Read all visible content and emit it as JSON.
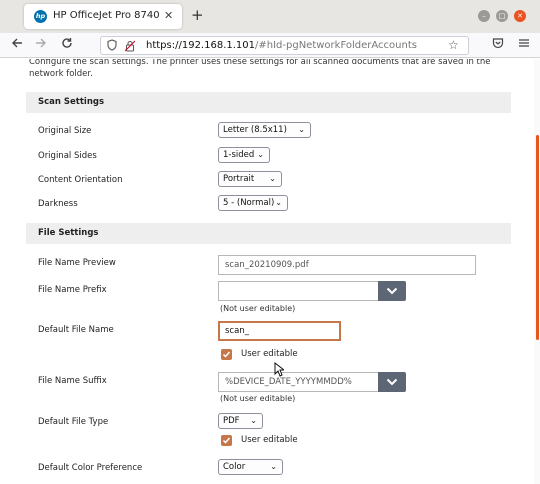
{
  "browser": {
    "tab_title": "HP OfficeJet Pro 8740",
    "tab_close": "✕",
    "favicon_text": "hp",
    "new_tab": "+",
    "url_host": "https://192.168.1.101",
    "url_path": "/#hId-pgNetworkFolderAccounts"
  },
  "page": {
    "intro": "Configure the scan settings. The printer uses these settings for all scanned documents that are saved in the network folder.",
    "scan_settings": {
      "header": "Scan Settings",
      "rows": [
        {
          "label": "Original Size",
          "value": "Letter (8.5x11)"
        },
        {
          "label": "Original Sides",
          "value": "1-sided"
        },
        {
          "label": "Content Orientation",
          "value": "Portrait"
        },
        {
          "label": "Darkness",
          "value": "5 - (Normal)"
        }
      ]
    },
    "file_settings": {
      "header": "File Settings",
      "preview_label": "File Name Preview",
      "preview_value": "scan_20210909.pdf",
      "prefix_label": "File Name Prefix",
      "prefix_value": "",
      "prefix_note": "(Not user editable)",
      "default_name_label": "Default File Name",
      "default_name_value": "scan_",
      "default_name_editable": "User editable",
      "suffix_label": "File Name Suffix",
      "suffix_value": "%DEVICE_DATE_YYYYMMDD%",
      "suffix_note": "(Not user editable)",
      "file_type_label": "Default File Type",
      "file_type_value": "PDF",
      "file_type_editable": "User editable",
      "color_label": "Default Color Preference",
      "color_value": "Color"
    }
  },
  "colors": {
    "accent": "#c5774a",
    "combo_button": "#5c6675",
    "section_bg": "#eeeeee",
    "scrollbar": "#e95420"
  }
}
